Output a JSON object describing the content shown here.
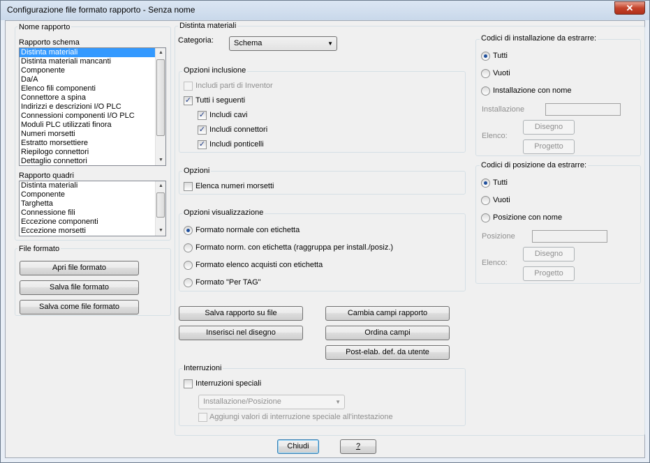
{
  "window": {
    "title": "Configurazione file formato rapporto - Senza nome",
    "close": "✕"
  },
  "nome_rapporto": {
    "label": "Nome rapporto",
    "schema_label": "Rapporto schema",
    "schema_items": [
      "Distinta materiali",
      "Distinta materiali mancanti",
      "Componente",
      "Da/A",
      "Elenco fili componenti",
      "Connettore a spina",
      "Indirizzi e descrizioni I/O PLC",
      "Connessioni componenti I/O PLC",
      "Moduli PLC utilizzati finora",
      "Numeri morsetti",
      "Estratto morsettiere",
      "Riepilogo connettori",
      "Dettaglio connettori"
    ],
    "quadri_label": "Rapporto quadri",
    "quadri_items": [
      "Distinta materiali",
      "Componente",
      "Targhetta",
      "Connessione fili",
      "Eccezione componenti",
      "Eccezione morsetti"
    ]
  },
  "file_formato": {
    "label": "File formato",
    "apri": "Apri file formato",
    "salva": "Salva file formato",
    "salva_come": "Salva come file formato"
  },
  "distinta": {
    "label": "Distinta materiali",
    "categoria_label": "Categoria:",
    "categoria_value": "Schema",
    "opzioni_inclusione": {
      "label": "Opzioni inclusione",
      "includi_inventor": "Includi parti di Inventor",
      "tutti_seguenti": "Tutti i seguenti",
      "cavi": "Includi cavi",
      "connettori": "Includi connettori",
      "ponticelli": "Includi ponticelli"
    },
    "opzioni": {
      "label": "Opzioni",
      "elenca": "Elenca numeri morsetti"
    },
    "visualizzazione": {
      "label": "Opzioni visualizzazione",
      "r1": "Formato normale con etichetta",
      "r2": "Formato norm. con etichetta (raggruppa per install./posiz.)",
      "r3": "Formato elenco acquisti con etichetta",
      "r4": "Formato \"Per TAG\""
    },
    "buttons": {
      "salva_rapporto": "Salva rapporto su file",
      "inserisci": "Inserisci nel disegno",
      "cambia": "Cambia campi rapporto",
      "ordina": "Ordina campi",
      "post": "Post-elab. def. da utente"
    },
    "interruzioni": {
      "label": "Interruzioni",
      "speciali": "Interruzioni speciali",
      "combo": "Installazione/Posizione",
      "aggiungi": "Aggiungi valori di interruzione speciale all'intestazione"
    }
  },
  "installazione": {
    "label": "Codici di installazione da estrarre:",
    "tutti": "Tutti",
    "vuoti": "Vuoti",
    "con_nome": "Installazione con nome",
    "field_label": "Installazione",
    "elenco": "Elenco:",
    "disegno": "Disegno",
    "progetto": "Progetto"
  },
  "posizione": {
    "label": "Codici di posizione da estrarre:",
    "tutti": "Tutti",
    "vuoti": "Vuoti",
    "con_nome": "Posizione con nome",
    "field_label": "Posizione",
    "elenco": "Elenco:",
    "disegno": "Disegno",
    "progetto": "Progetto"
  },
  "footer": {
    "chiudi": "Chiudi",
    "help": "?"
  }
}
